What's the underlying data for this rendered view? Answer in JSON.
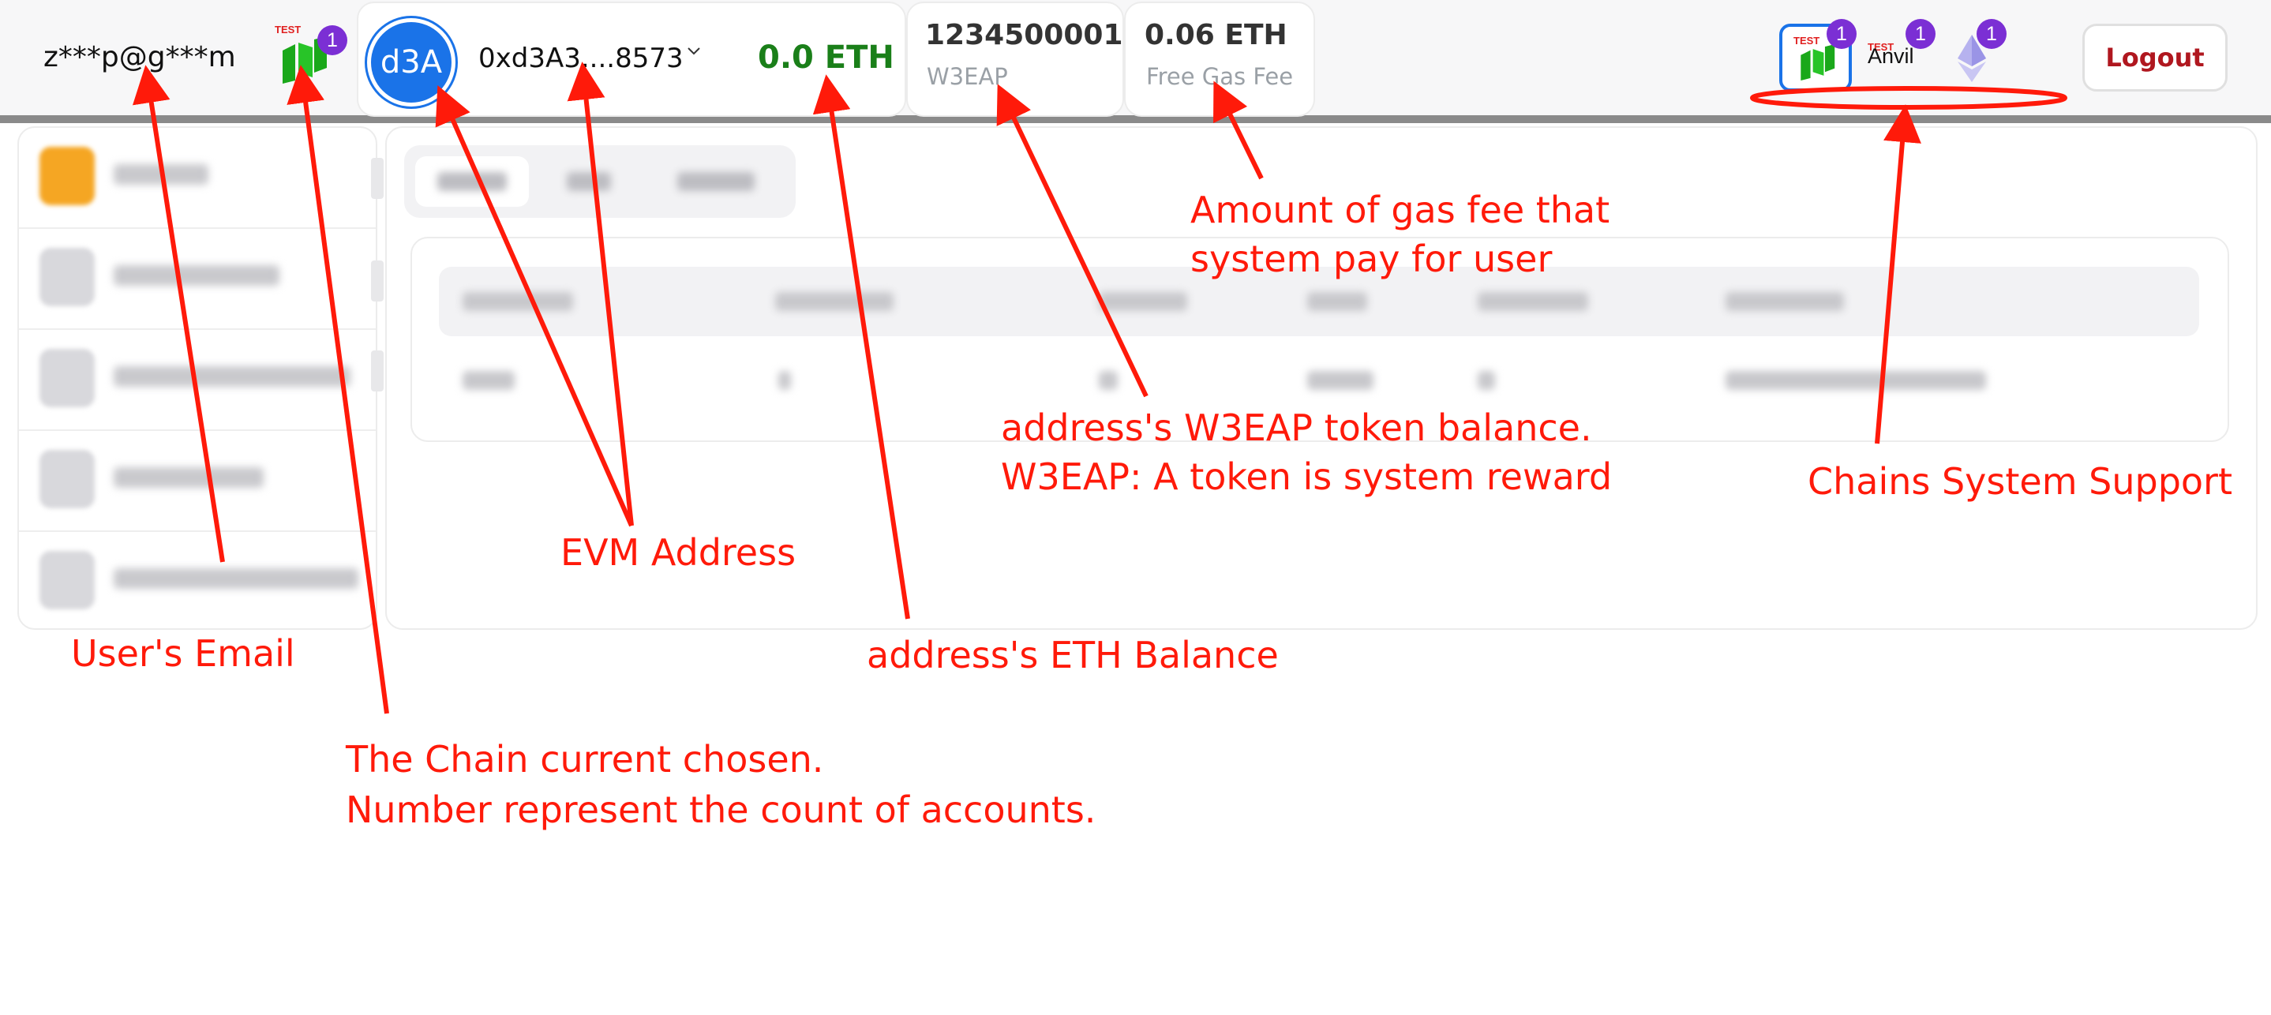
{
  "header": {
    "user_email": "z***p@g***m",
    "current_chain": {
      "tag": "TEST",
      "account_count": "1",
      "icon": "green-chain-logo-icon"
    },
    "account": {
      "avatar_text": "d3A",
      "address": "0xd3A3....8573",
      "eth_balance": "0.0 ETH",
      "chevron": "chevron-down-icon"
    },
    "w3eap_card": {
      "value": "1234500001",
      "label": "W3EAP"
    },
    "gas_card": {
      "value": "0.06 ETH",
      "label": "Free Gas Fee"
    },
    "supported_chains": [
      {
        "tag": "TEST",
        "count": "1",
        "icon": "green-chain-logo-icon"
      },
      {
        "tag": "TEST",
        "name": "Anvil",
        "count": "1"
      },
      {
        "count": "1",
        "icon": "ethereum-diamond-icon"
      }
    ],
    "logout_label": "Logout"
  },
  "colors": {
    "accent_blue": "#1a73e8",
    "eth_green": "#1a7f19",
    "badge_purple": "#7b2fd4",
    "annotation_red": "#ff1a0a",
    "logout_red": "#b0171f"
  },
  "annotations": {
    "email": "User's Email",
    "chain_line1": "The Chain current chosen.",
    "chain_line2": "Number represent the count of accounts.",
    "evm": "EVM Address",
    "eth": "address's ETH Balance",
    "w3_line1": "address's W3EAP token balance.",
    "w3_line2": "W3EAP: A token is system reward",
    "gas_line1": "Amount of gas fee that",
    "gas_line2": "system pay for user",
    "chains": "Chains System Support"
  }
}
